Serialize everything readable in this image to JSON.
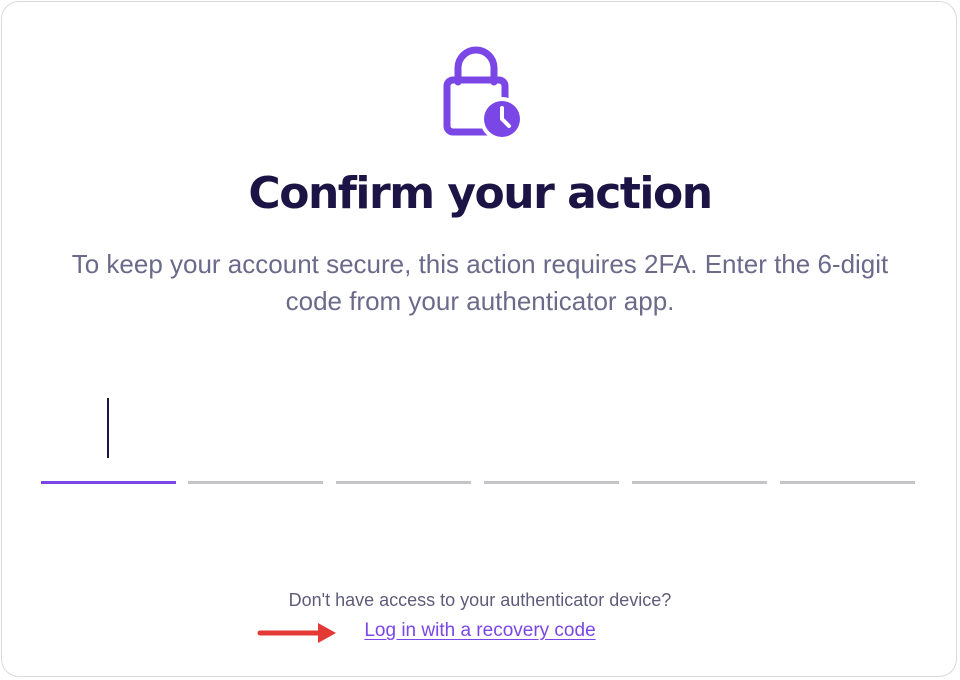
{
  "colors": {
    "accent": "#7a46e6",
    "title": "#1c1444",
    "muted_text": "#6c6a8a",
    "inactive_underline": "#c4c4c8",
    "annotation_arrow": "#e53935"
  },
  "header": {
    "icon": "lock-clock-icon",
    "title": "Confirm your action",
    "subtitle": "To keep your account secure, this action requires 2FA. Enter the 6-digit code from your authenticator app."
  },
  "code_input": {
    "length": 6,
    "values": [
      "",
      "",
      "",
      "",
      "",
      ""
    ],
    "active_index": 0
  },
  "recovery": {
    "prompt": "Don't have access to your authenticator device?",
    "link_label": "Log in with a recovery code"
  },
  "annotation": {
    "icon": "arrow-right-icon"
  }
}
